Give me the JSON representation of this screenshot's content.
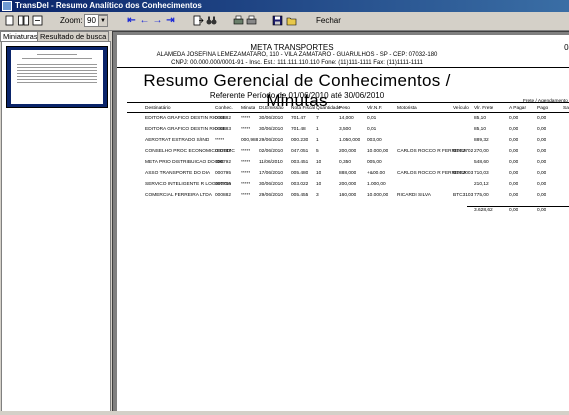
{
  "window": {
    "title": "TransDel - Resumo Analítico dos Conhecimentos"
  },
  "toolbar": {
    "zoom_label": "Zoom:",
    "zoom_value": "90",
    "close_label": "Fechar"
  },
  "tabs": [
    {
      "label": "Miniaturas",
      "active": true
    },
    {
      "label": "Resultado de busca",
      "active": false
    }
  ],
  "report": {
    "company": "META TRANSPORTES",
    "page_no": "08",
    "address": "ALAMEDA JOSEFINA LEMEZAMATARO, 110 - VILA ZAMATARO - GUARULHOS - SP - CEP: 07032-180",
    "ids": "CNPJ: 00.000.000/0001-91 - Insc. Est.: 111.111.110.110 Fone: (11)111-1111 Fax: (11)1111-1111",
    "title": "Resumo Gerencial de Conhecimentos / Minutas",
    "period": "Referente Período de 01/06/2010 até 30/06/2010",
    "group_header": "Frete / Agendamento",
    "columns": [
      "Destinatário",
      "Conhec.",
      "Minuta",
      "Dt.Emissão",
      "Nota Fiscal",
      "Quantidade",
      "Peso",
      "Vlr.N.F.",
      "Motorista",
      "Veículo",
      "Vlr. Frete",
      "A Pagar",
      "Pago",
      "Saldo"
    ],
    "rows": [
      [
        "EDITORA GRAFICO DESTIN RIO SE",
        "000882",
        "*****",
        "30/06/2010",
        "701.47",
        "7",
        "14,000",
        "0,01",
        "",
        "",
        "85,10",
        "0,00",
        "0,00",
        ""
      ],
      [
        "EDITORA GRAFICO DESTIN RIO SE",
        "000883",
        "*****",
        "30/06/2010",
        "701.48",
        "1",
        "3,500",
        "0,01",
        "",
        "",
        "85,10",
        "0,00",
        "0,00",
        ""
      ],
      [
        "AEROTRAT ESTRADO S/IND",
        "*****",
        "000,988",
        "29/06/2010",
        "000.230",
        "1",
        "1.050,000",
        "003,00",
        "",
        "",
        "889,32",
        "0,00",
        "0,00",
        ""
      ],
      [
        "CONSELHO PROC ECONOMICO DEDIC",
        "000787",
        "*****",
        "02/06/2010",
        "047.051",
        "5",
        "200,000",
        "10.000,00",
        "CARLOS ROCCO R FERREIRA",
        "BTC3702",
        "270,00",
        "0,00",
        "0,00",
        ""
      ],
      [
        "META PRIO DISTRIBUICAO DO DIE",
        "000792",
        "*****",
        "11/06/2010",
        "003.451",
        "10",
        "0,350",
        "005,00",
        "",
        "",
        "548,60",
        "0,00",
        "0,00",
        ""
      ],
      [
        "ASSO TRANSPORTE DO DIA",
        "000795",
        "*****",
        "17/06/2010",
        "005.480",
        "10",
        "888,000",
        "+&00.00",
        "CARLOS ROCCO R FERREIRA",
        "BTC3003",
        "710,03",
        "0,00",
        "0,00",
        ""
      ],
      [
        "SERVICO INTELIGENTE R LOGISTICA",
        "000799",
        "*****",
        "30/06/2010",
        "003.022",
        "10",
        "200,000",
        "1.000,00",
        "",
        "",
        "210,12",
        "0,00",
        "0,00",
        ""
      ],
      [
        "COMERCIAL FERREIRA LTDA",
        "000882",
        "*****",
        "29/06/2010",
        "005.455",
        "3",
        "160,000",
        "10.000,00",
        "RICARDI SILVA",
        "BTC3103",
        "775,00",
        "0,00",
        "0,00",
        ""
      ]
    ],
    "totals": [
      "3.628,62",
      "0,00",
      "0,00"
    ]
  },
  "colors": {
    "titlebar_start": "#0a246a",
    "titlebar_end": "#3a6ea5",
    "nav_arrow": "#1d2bd6"
  }
}
